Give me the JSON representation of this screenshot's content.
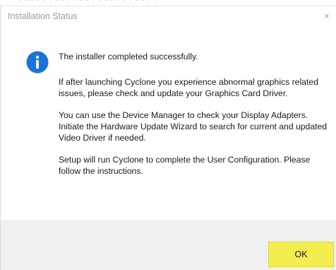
{
  "dialog": {
    "title": "Installation Status",
    "close_glyph": "×",
    "icon": "info-icon",
    "message": {
      "headline": "The installer completed successfully.",
      "paragraphs": [
        "If after launching Cyclone you experience abnormal graphics related issues, please check and update your Graphics Card Driver.",
        "You can use the Device Manager to check your Display Adapters. Initiate the Hardware Update Wizard to search for current and updated Video Driver if needed.",
        "Setup will run Cyclone to complete the User Configuration. Please follow the instructions."
      ]
    },
    "ok_label": "OK"
  },
  "colors": {
    "info_icon_blue": "#1a73d8",
    "ok_highlight": "#f2ee4f",
    "dialog_background": "#f0f0f0"
  }
}
